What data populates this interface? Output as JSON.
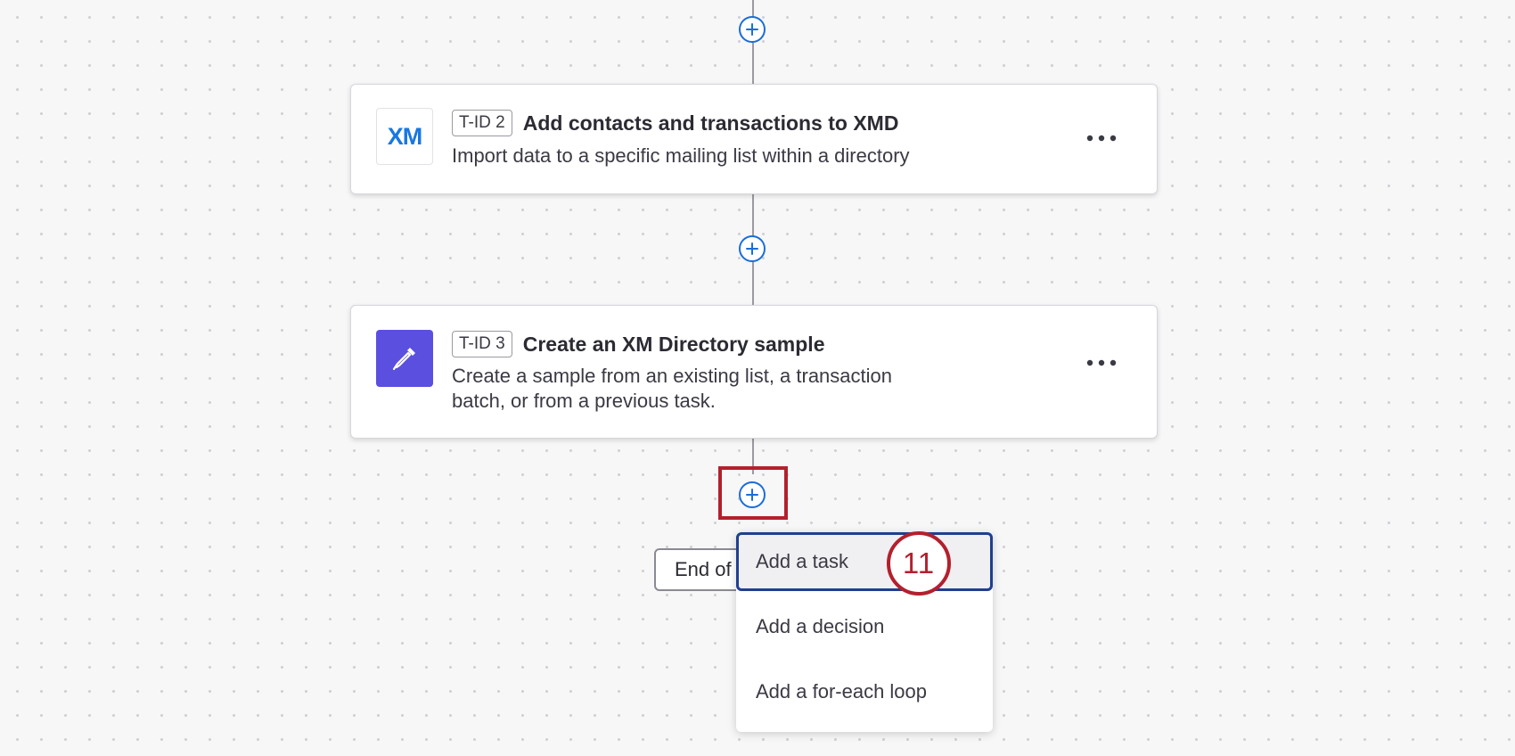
{
  "workflow": {
    "tasks": [
      {
        "tid": "T-ID 2",
        "title": "Add contacts and transactions to XMD",
        "description": "Import data to a specific mailing list within a directory",
        "icon": "xm-logo-icon",
        "icon_text": "XM"
      },
      {
        "tid": "T-ID 3",
        "title": "Create an XM Directory sample",
        "description_line1": "Create a sample from an existing list, a transaction",
        "description_line2": "batch, or from a previous task.",
        "icon": "eyedropper-icon"
      }
    ],
    "end_label": "End of",
    "add_button_icon": "plus-circle-icon",
    "more_icon": "more-horizontal-icon"
  },
  "add_menu": {
    "items": [
      {
        "label": "Add a task",
        "active": true
      },
      {
        "label": "Add a decision",
        "active": false
      },
      {
        "label": "Add a for-each loop",
        "active": false
      }
    ]
  },
  "annotation": {
    "step_number": "11"
  },
  "colors": {
    "accent_blue": "#1a6ddb",
    "highlight_red": "#b3202d",
    "sample_icon_bg": "#5b4fe0",
    "xm_blue": "#1877e0",
    "menu_focus_border": "#1f3f8f"
  }
}
